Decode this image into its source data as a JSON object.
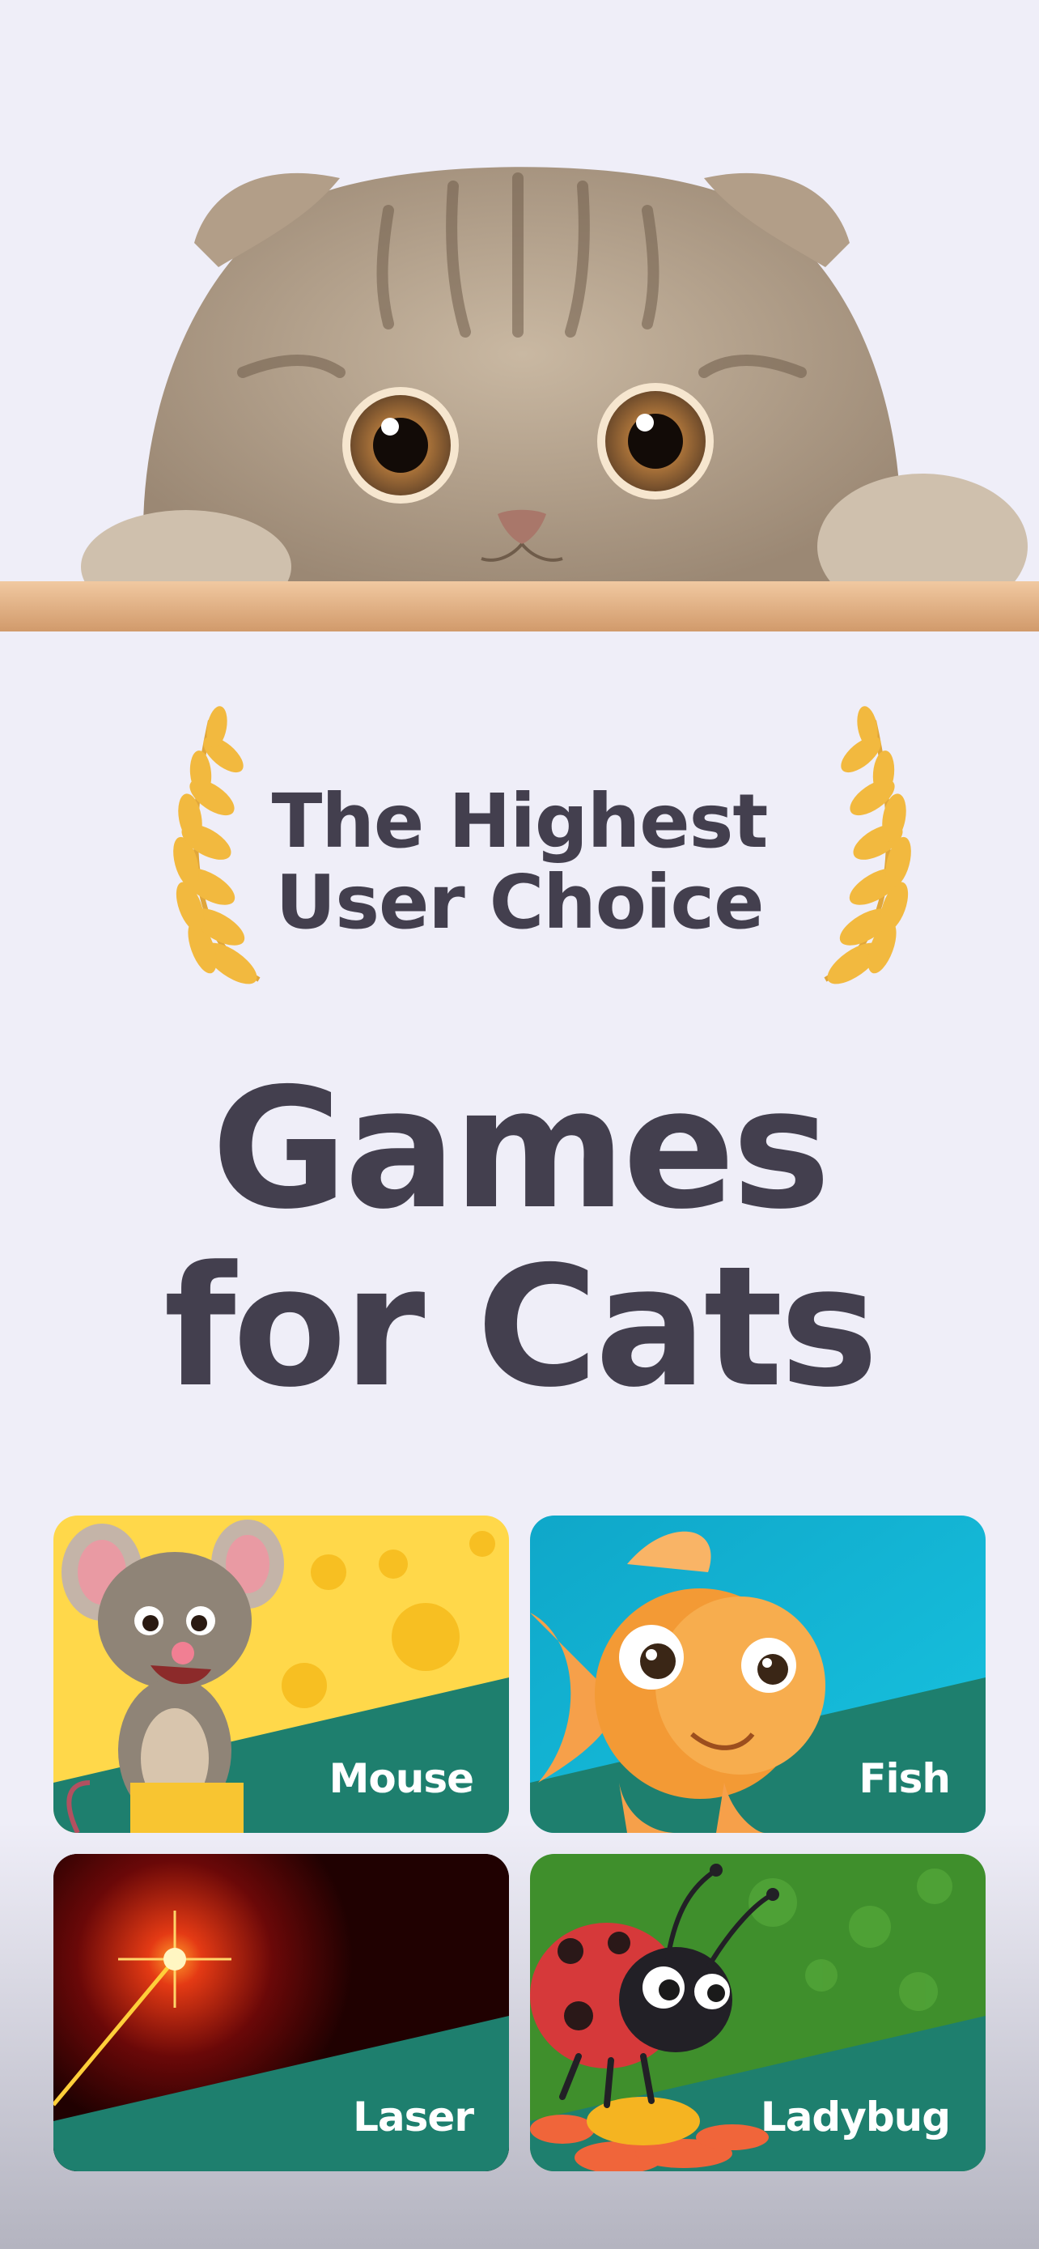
{
  "hero": {
    "image": "cat-peeking-over-ledge"
  },
  "badge": {
    "line1": "The Highest",
    "line2": "User Choice",
    "icon": "laurel-wreath-icon"
  },
  "headline": {
    "line1": "Games",
    "line2": "for Cats"
  },
  "games": [
    {
      "label": "Mouse",
      "icon": "mouse-icon"
    },
    {
      "label": "Fish",
      "icon": "fish-icon"
    },
    {
      "label": "Laser",
      "icon": "laser-icon"
    },
    {
      "label": "Ladybug",
      "icon": "ladybug-icon"
    }
  ],
  "colors": {
    "background": "#efeef8",
    "text": "#433f4e",
    "card_band": "#1e7f6e",
    "laurel": "#f2b93f"
  }
}
